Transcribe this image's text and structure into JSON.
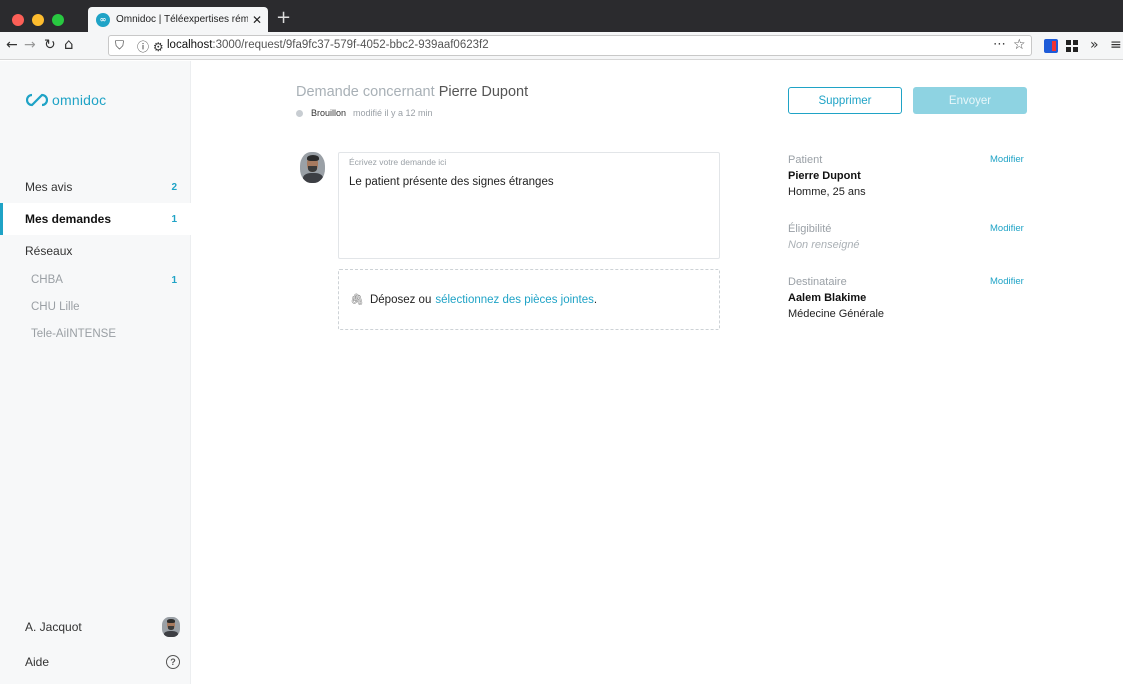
{
  "browser": {
    "tab_title": "Omnidoc | Téléexpertises rému",
    "url_host": "localhost",
    "url_path": ":3000/request/9fa9fc37-579f-4052-bbc2-939aaf0623f2"
  },
  "app": {
    "logo_text": "omnidoc",
    "accent_color": "#1fa3c6"
  },
  "sidebar": {
    "items": [
      {
        "label": "Mes avis",
        "count": "2"
      },
      {
        "label": "Mes demandes",
        "count": "1"
      },
      {
        "label": "Réseaux",
        "count": ""
      }
    ],
    "networks": [
      {
        "label": "CHBA",
        "count": "1"
      },
      {
        "label": "CHU Lille",
        "count": ""
      },
      {
        "label": "Tele-AiINTENSE",
        "count": ""
      }
    ],
    "user_name": "A. Jacquot",
    "help_label": "Aide"
  },
  "request": {
    "title_prefix": "Demande concernant",
    "patient_name": "Pierre Dupont",
    "status": "Brouillon",
    "modified": "modifié il y a 12 min",
    "delete_label": "Supprimer",
    "send_label": "Envoyer",
    "composer_placeholder": "Écrivez votre demande ici",
    "composer_text": "Le patient présente des signes étranges",
    "drop_text": "Déposez ou",
    "drop_link": "sélectionnez des pièces jointes",
    "drop_suffix": "."
  },
  "details": {
    "patient_label": "Patient",
    "patient_name": "Pierre Dupont",
    "patient_info": "Homme, 25 ans",
    "eligibility_label": "Éligibilité",
    "eligibility_value": "Non renseigné",
    "recipient_label": "Destinataire",
    "recipient_name": "Aalem Blakime",
    "recipient_specialty": "Médecine Générale",
    "edit_label": "Modifier"
  }
}
